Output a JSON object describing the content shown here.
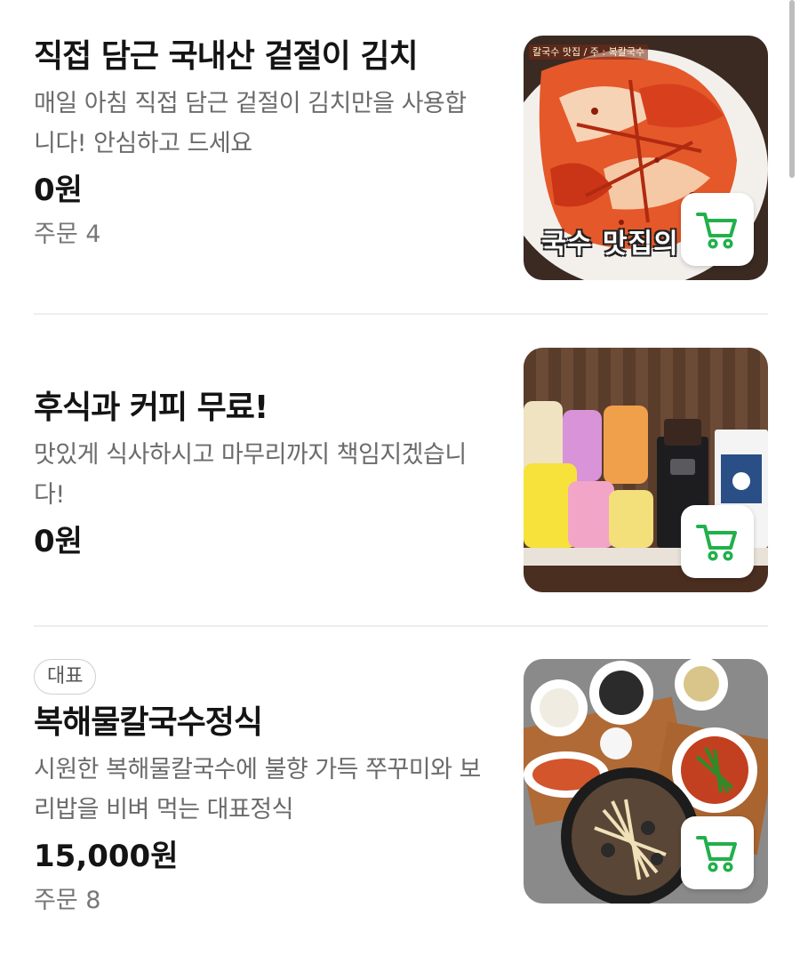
{
  "menu": {
    "items": [
      {
        "title": "직접 담근 국내산 겉절이 김치",
        "description": "매일 아침 직접 담근 겉절이 김치만을 사용합니다! 안심하고 드세요",
        "price": "0원",
        "orders": "주문 4",
        "image_icon": "kimchi-photo",
        "image_caption": "국수 맛집의 생 절",
        "image_topnote": "칼국수 맛집 / 주 : 복칼국수"
      },
      {
        "title": "후식과 커피 무료!",
        "description": "맛있게 식사하시고 마무리까지 책임지겠습니다!",
        "price": "0원",
        "image_icon": "dessert-coffee-photo"
      },
      {
        "badge": "대표",
        "title": "복해물칼국수정식",
        "description": "시원한 복해물칼국수에 불향 가득 쭈꾸미와 보리밥을 비벼 먹는 대표정식",
        "price": "15,000원",
        "orders": "주문 8",
        "image_icon": "set-meal-photo"
      }
    ],
    "cart_icon": "cart-icon"
  },
  "colors": {
    "cart_accent": "#22b04b",
    "title": "#141414",
    "description": "#6b6b6b",
    "divider": "#eeeeee"
  }
}
